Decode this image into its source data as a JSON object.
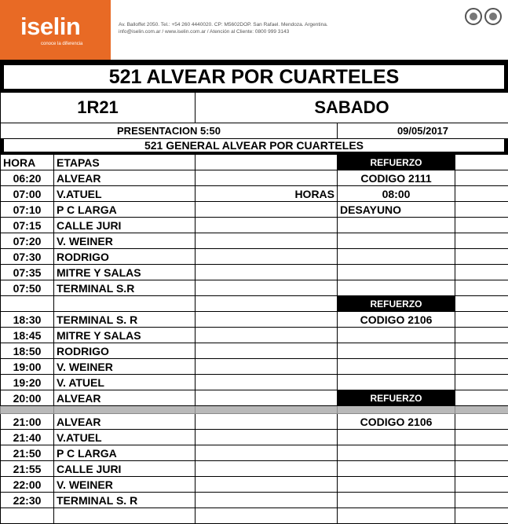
{
  "header": {
    "logo_text": "iselin",
    "logo_tagline": "conoce la diferencia",
    "address_line1": "Av. Balloffet 2050. Tel.: +54 260 4440020. CP: M5602DOP. San Rafael. Mendoza. Argentina.",
    "address_line2": "info@iselin.com.ar / www.iselin.com.ar / Atención al Cliente: 0800 999 3143",
    "seals": [
      "seal-1",
      "seal-2"
    ],
    "brand_color": "#e86a25"
  },
  "title": "521 ALVEAR POR CUARTELES",
  "service_code": "1R21",
  "day": "SABADO",
  "presentation": "PRESENTACION 5:50",
  "date": "09/05/2017",
  "route_name": "521 GENERAL ALVEAR POR CUARTELES",
  "schedule": {
    "rows": [
      {
        "time": "HORA",
        "stage": "ETAPAS",
        "mid": "",
        "note": "REFUERZO",
        "note_style": "badge"
      },
      {
        "time": "06:20",
        "stage": "ALVEAR",
        "mid": "",
        "note": "CODIGO 2111"
      },
      {
        "time": "07:00",
        "stage": "V.ATUEL",
        "mid": "HORAS",
        "note": "08:00"
      },
      {
        "time": "07:10",
        "stage": "P C LARGA",
        "mid": "",
        "note": "DESAYUNO",
        "note_align": "left"
      },
      {
        "time": "07:15",
        "stage": "CALLE JURI",
        "mid": "",
        "note": ""
      },
      {
        "time": "07:20",
        "stage": "V. WEINER",
        "mid": "",
        "note": ""
      },
      {
        "time": "07:30",
        "stage": "RODRIGO",
        "mid": "",
        "note": ""
      },
      {
        "time": "07:35",
        "stage": "MITRE Y SALAS",
        "mid": "",
        "note": ""
      },
      {
        "time": "07:50",
        "stage": "TERMINAL S.R",
        "mid": "",
        "note": ""
      },
      {
        "time": "",
        "stage": "",
        "mid": "",
        "note": "REFUERZO",
        "note_style": "badge"
      },
      {
        "time": "18:30",
        "stage": "TERMINAL S. R",
        "mid": "",
        "note": "CODIGO 2106"
      },
      {
        "time": "18:45",
        "stage": "MITRE Y SALAS",
        "mid": "",
        "note": ""
      },
      {
        "time": "18:50",
        "stage": "RODRIGO",
        "mid": "",
        "note": ""
      },
      {
        "time": "19:00",
        "stage": "V. WEINER",
        "mid": "",
        "note": ""
      },
      {
        "time": "19:20",
        "stage": "V. ATUEL",
        "mid": "",
        "note": ""
      },
      {
        "time": "20:00",
        "stage": "ALVEAR",
        "mid": "",
        "note": "REFUERZO",
        "note_style": "badge"
      },
      {
        "separator": true
      },
      {
        "time": "21:00",
        "stage": "ALVEAR",
        "mid": "",
        "note": "CODIGO 2106"
      },
      {
        "time": "21:40",
        "stage": "V.ATUEL",
        "mid": "",
        "note": ""
      },
      {
        "time": "21:50",
        "stage": "P C LARGA",
        "mid": "",
        "note": ""
      },
      {
        "time": "21:55",
        "stage": "CALLE JURI",
        "mid": "",
        "note": ""
      },
      {
        "time": "22:00",
        "stage": "V. WEINER",
        "mid": "",
        "note": ""
      },
      {
        "time": "22:30",
        "stage": "TERMINAL S. R",
        "mid": "",
        "note": ""
      },
      {
        "time": "",
        "stage": "",
        "mid": "",
        "note": ""
      }
    ]
  }
}
